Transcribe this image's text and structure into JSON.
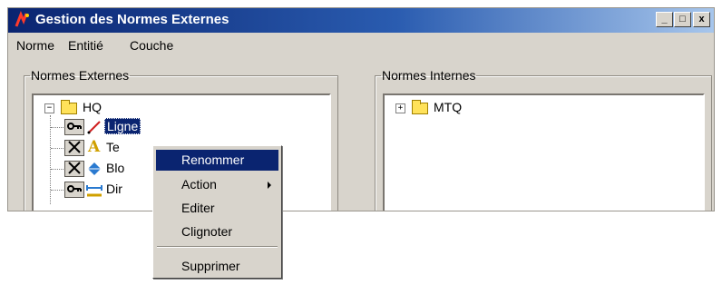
{
  "window": {
    "title": "Gestion des Normes Externes",
    "controls": {
      "minimize": "_",
      "maximize": "□",
      "close": "x"
    }
  },
  "menubar": {
    "items": [
      "Norme",
      "Entitié",
      "Couche"
    ]
  },
  "left_panel": {
    "legend": "Normes Externes",
    "root": {
      "expander": "−",
      "label": "HQ"
    },
    "children": [
      {
        "label": "Ligne",
        "icon": "line-icon",
        "state": "key-icon",
        "selected": true
      },
      {
        "label": "Te",
        "icon": "text-a-icon",
        "state": "x-icon"
      },
      {
        "label": "Blo",
        "icon": "block-diamond-icon",
        "state": "x-icon"
      },
      {
        "label": "Dir",
        "icon": "dimension-icon",
        "state": "key-icon"
      }
    ]
  },
  "right_panel": {
    "legend": "Normes Internes",
    "root": {
      "expander": "+",
      "label": "MTQ"
    }
  },
  "context_menu": {
    "items": [
      "Renommer",
      "Action",
      "Editer",
      "Clignoter",
      "Supprimer"
    ],
    "selected": "Renommer"
  },
  "colors": {
    "title_dark": "#0a2470",
    "title_light": "#a7c6ec",
    "selection": "#0a2470",
    "window_bg": "#d8d4cc"
  }
}
